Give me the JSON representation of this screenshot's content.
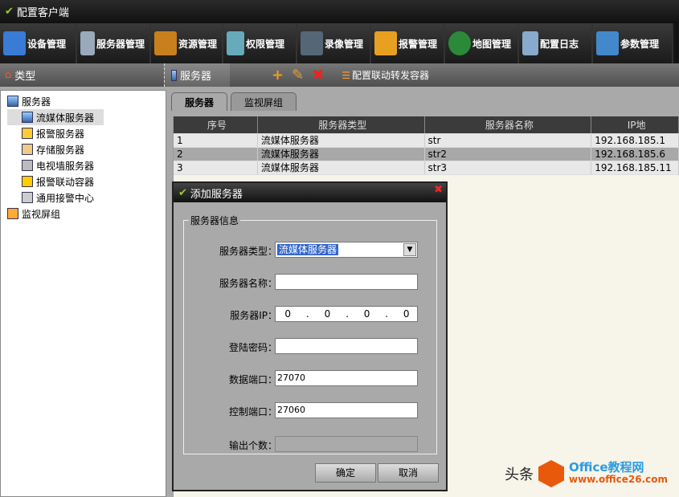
{
  "window": {
    "title": "配置客户端"
  },
  "toolbar": [
    "设备管理",
    "服务器管理",
    "资源管理",
    "权限管理",
    "录像管理",
    "报警管理",
    "地图管理",
    "配置日志",
    "参数管理"
  ],
  "subbar": {
    "left": "类型",
    "tab": "服务器",
    "action": "配置联动转发容器"
  },
  "tree": {
    "root": "服务器",
    "children": [
      "流媒体服务器",
      "报警服务器",
      "存储服务器",
      "电视墙服务器",
      "报警联动容器",
      "通用接警中心"
    ],
    "root2": "监视屏组"
  },
  "tabs": [
    "服务器",
    "监视屏组"
  ],
  "table": {
    "headers": [
      "序号",
      "服务器类型",
      "服务器名称",
      "IP地"
    ],
    "rows": [
      [
        "1",
        "流媒体服务器",
        "str",
        "192.168.185.1"
      ],
      [
        "2",
        "流媒体服务器",
        "str2",
        "192.168.185.6"
      ],
      [
        "3",
        "流媒体服务器",
        "str3",
        "192.168.185.11"
      ]
    ]
  },
  "dialog": {
    "title": "添加服务器",
    "group": "服务器信息",
    "fields": {
      "type_label": "服务器类型：",
      "type_value": "流媒体服务器",
      "name_label": "服务器名称：",
      "ip_label": "服务器IP：",
      "ip": [
        "0",
        "0",
        "0",
        "0"
      ],
      "pwd_label": "登陆密码：",
      "data_port_label": "数据端口：",
      "data_port": "27070",
      "ctrl_port_label": "控制端口：",
      "ctrl_port": "27060",
      "out_label": "输出个数："
    },
    "ok": "确定",
    "cancel": "取消"
  },
  "watermark": {
    "text": "头条",
    "brand": "Office教程网",
    "url": "www.office26.com"
  }
}
